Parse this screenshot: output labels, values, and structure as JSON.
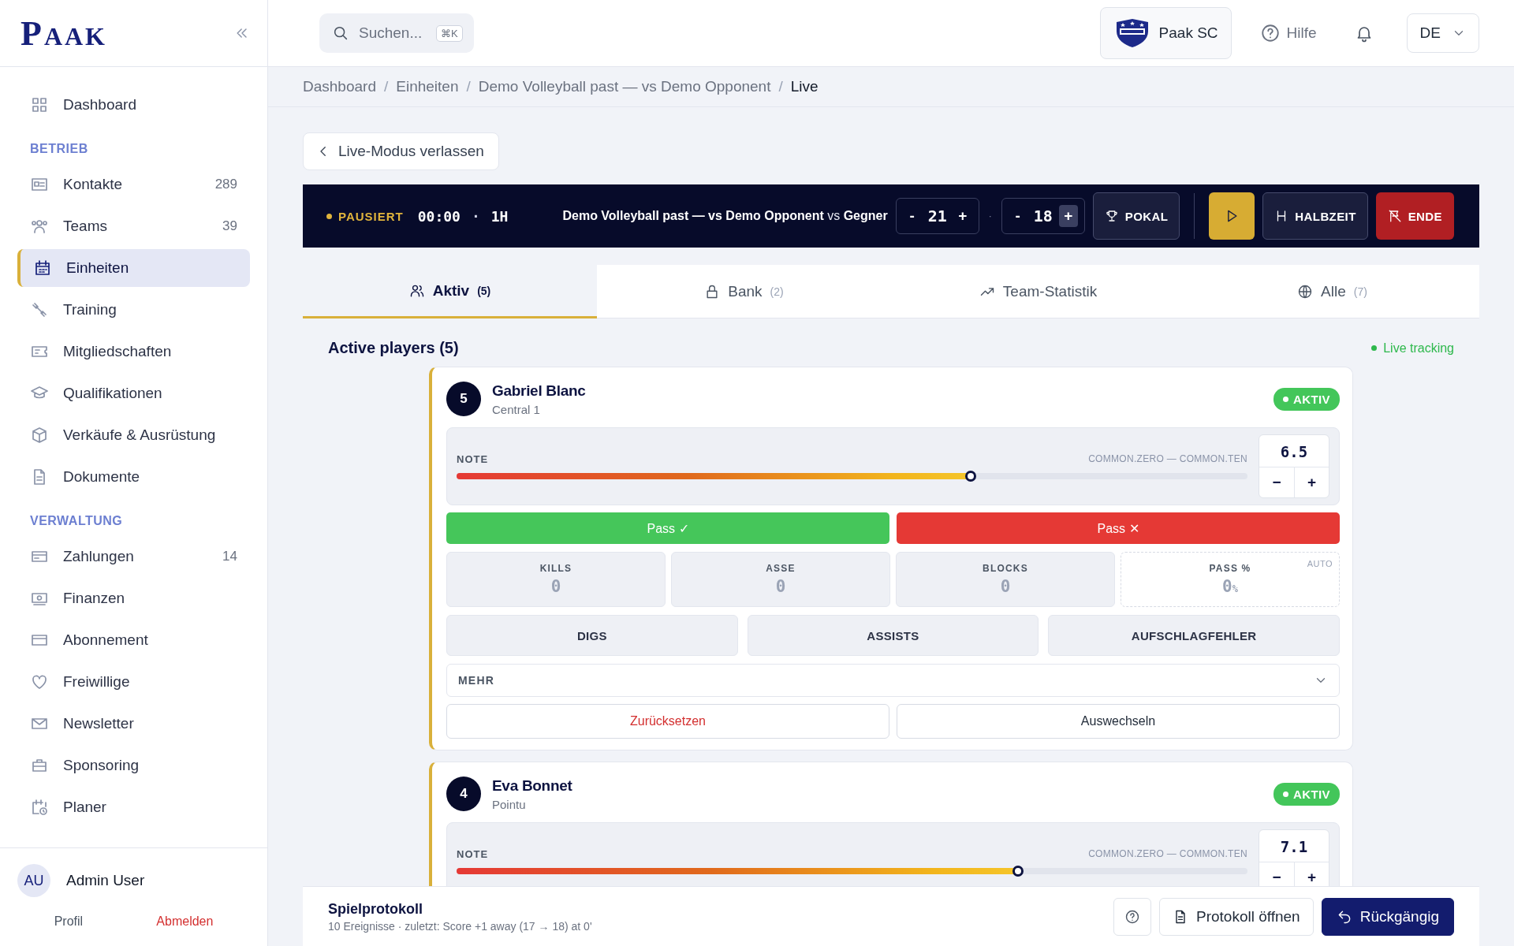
{
  "sidebar": {
    "logo": "PAAK",
    "sections": [
      {
        "items": [
          {
            "label": "Dashboard",
            "selected": false
          }
        ]
      },
      {
        "title": "BETRIEB",
        "items": [
          {
            "label": "Kontakte",
            "count": "289",
            "selected": false
          },
          {
            "label": "Teams",
            "count": "39",
            "selected": false
          },
          {
            "label": "Einheiten",
            "selected": true
          },
          {
            "label": "Training",
            "selected": false
          },
          {
            "label": "Mitgliedschaften",
            "selected": false
          },
          {
            "label": "Qualifikationen",
            "selected": false
          },
          {
            "label": "Verkäufe & Ausrüstung",
            "selected": false
          },
          {
            "label": "Dokumente",
            "selected": false
          }
        ]
      },
      {
        "title": "VERWALTUNG",
        "items": [
          {
            "label": "Zahlungen",
            "count": "14",
            "selected": false
          },
          {
            "label": "Finanzen",
            "selected": false
          },
          {
            "label": "Abonnement",
            "selected": false
          },
          {
            "label": "Freiwillige",
            "selected": false
          },
          {
            "label": "Newsletter",
            "selected": false
          },
          {
            "label": "Sponsoring",
            "selected": false
          },
          {
            "label": "Planer",
            "selected": false
          }
        ]
      }
    ],
    "user": {
      "initials": "AU",
      "name": "Admin User",
      "profile": "Profil",
      "logout": "Abmelden"
    }
  },
  "topbar": {
    "search": {
      "placeholder": "Suchen...",
      "shortcut": "⌘K"
    },
    "club": "Paak SC",
    "help": "Hilfe",
    "language": "DE"
  },
  "breadcrumb": {
    "separator": "/",
    "items": [
      "Dashboard",
      "Einheiten",
      "Demo Volleyball past — vs Demo Opponent",
      "Live"
    ]
  },
  "back_button": "Live-Modus verlassen",
  "scoreboard": {
    "status": "PAUSIERT",
    "clock": "00:00",
    "separator": "·",
    "period": "1H",
    "match": "**Demo Volleyball past — vs Demo Opponent** vs **Gegner**",
    "scores": [
      {
        "minus": "-",
        "value": "21",
        "plus": "+"
      },
      {
        "minus": "-",
        "value": "18",
        "plus": "+"
      }
    ],
    "score_separator": "·",
    "buttons": [
      {
        "kind": "trophy",
        "label": "POKAL"
      },
      {
        "kind": "play"
      },
      {
        "kind": "halftime",
        "label": "HALBZEIT"
      },
      {
        "kind": "end",
        "label": "ENDE"
      }
    ]
  },
  "tabs": [
    {
      "label": "Aktiv",
      "count": "(5)",
      "selected": true
    },
    {
      "label": "Bank",
      "count": "(2)",
      "selected": false
    },
    {
      "label": "Team-Statistik",
      "selected": false
    },
    {
      "label": "Alle",
      "count": "(7)",
      "selected": false
    }
  ],
  "section": {
    "title": "Active players (5)",
    "live": "Live tracking"
  },
  "players": [
    {
      "number": "5",
      "name": "Gabriel Blanc",
      "position": "Central 1",
      "status": "AKTIV",
      "note": {
        "label": "NOTE",
        "range": "COMMON.ZERO — COMMON.TEN",
        "value": "6.5",
        "level": 0.65,
        "minus": "−",
        "plus": "+"
      },
      "pass_buttons": [
        {
          "kind": "success",
          "label": "Pass ✓"
        },
        {
          "kind": "fail",
          "label": "Pass ✕"
        }
      ],
      "stats": [
        {
          "kind": "counter",
          "label": "KILLS",
          "value": "0"
        },
        {
          "kind": "counter",
          "label": "ASSE",
          "value": "0"
        },
        {
          "kind": "counter",
          "label": "BLOCKS",
          "value": "0"
        },
        {
          "kind": "auto",
          "label": "PASS %",
          "value": "0",
          "unit": "%",
          "tag": "AUTO"
        }
      ],
      "actions": [
        "DIGS",
        "ASSISTS",
        "AUFSCHLAGFEHLER"
      ],
      "more": "MEHR",
      "footer_buttons": [
        {
          "kind": "danger",
          "label": "Zurücksetzen"
        },
        {
          "kind": "default",
          "label": "Auswechseln"
        }
      ]
    },
    {
      "number": "4",
      "name": "Eva Bonnet",
      "position": "Pointu",
      "status": "AKTIV",
      "note": {
        "label": "NOTE",
        "range": "COMMON.ZERO — COMMON.TEN",
        "value": "7.1",
        "level": 0.71,
        "minus": "−",
        "plus": "+"
      }
    }
  ],
  "log_bar": {
    "title": "Spielprotokoll",
    "subtitle": "10 Ereignisse · zuletzt: Score +1 away (17 → 18) at 0'",
    "open": "Protokoll öffnen",
    "undo": "Rückgängig"
  }
}
